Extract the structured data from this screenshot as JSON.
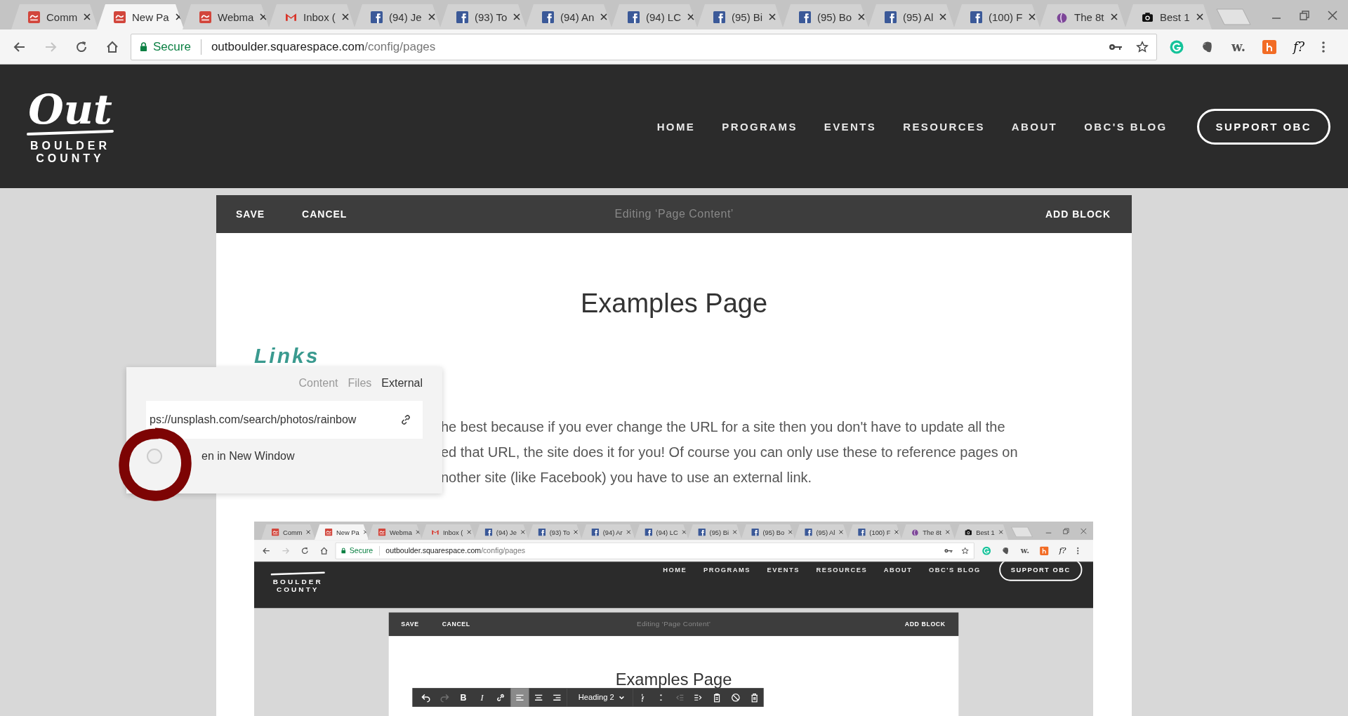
{
  "browser": {
    "tabs": [
      {
        "title": "Comm",
        "kind": "out",
        "selected": false
      },
      {
        "title": "New Pa",
        "kind": "out",
        "selected": true
      },
      {
        "title": "Webma",
        "kind": "out",
        "selected": false
      },
      {
        "title": "Inbox (",
        "kind": "mail",
        "selected": false
      },
      {
        "title": "(94) Je",
        "kind": "social",
        "selected": false
      },
      {
        "title": "(93) To",
        "kind": "social",
        "selected": false
      },
      {
        "title": "(94) An",
        "kind": "social",
        "selected": false
      },
      {
        "title": "(94) LC",
        "kind": "social",
        "selected": false
      },
      {
        "title": "(95) Bi",
        "kind": "social",
        "selected": false
      },
      {
        "title": "(95) Bo",
        "kind": "social",
        "selected": false
      },
      {
        "title": "(95) Al",
        "kind": "social",
        "selected": false
      },
      {
        "title": "(100) F",
        "kind": "social",
        "selected": false
      },
      {
        "title": "The 8t",
        "kind": "onion",
        "selected": false
      },
      {
        "title": "Best 1",
        "kind": "camera",
        "selected": false
      }
    ],
    "address": {
      "secure_label": "Secure",
      "host": "outboulder.squarespace.com",
      "path": "/config/pages"
    },
    "extensions": [
      {
        "kind": "grammarly"
      },
      {
        "kind": "evernote"
      },
      {
        "kind": "text",
        "label": "w."
      },
      {
        "kind": "honey"
      },
      {
        "kind": "text",
        "label": "f?"
      }
    ]
  },
  "site": {
    "logo": {
      "script": "Out",
      "line_1": "BOULDER",
      "line_2": "COUNTY"
    },
    "nav": [
      "HOME",
      "PROGRAMS",
      "EVENTS",
      "RESOURCES",
      "ABOUT",
      "OBC'S BLOG"
    ],
    "cta": "SUPPORT OBC"
  },
  "editor_bar": {
    "save": "SAVE",
    "cancel": "CANCEL",
    "status": "Editing ‘Page Content’",
    "add_block": "ADD BLOCK"
  },
  "page": {
    "title": "Examples Page",
    "heading": "Links",
    "paragraph_lines": [
      "he best because if you ever change the URL for a site then you don't have to update all the",
      "ed that URL, the site does it for you! Of course you can only use these to reference pages on",
      "nother site (like Facebook) you have to use an external link."
    ]
  },
  "link_popup": {
    "tabs": [
      {
        "label": "Content",
        "selected": false
      },
      {
        "label": "Files",
        "selected": false
      },
      {
        "label": "External",
        "selected": true
      }
    ],
    "url": "ps://unsplash.com/search/photos/rainbow",
    "new_window": {
      "label": "en in New Window",
      "checked": false
    }
  },
  "inner_screenshot": {
    "browser": {
      "tabs": [
        {
          "title": "Comm",
          "kind": "out",
          "selected": false
        },
        {
          "title": "New Pa",
          "kind": "out",
          "selected": true
        },
        {
          "title": "Webma",
          "kind": "out",
          "selected": false
        },
        {
          "title": "Inbox (",
          "kind": "mail",
          "selected": false
        },
        {
          "title": "(94) Je",
          "kind": "social",
          "selected": false
        },
        {
          "title": "(93) To",
          "kind": "social",
          "selected": false
        },
        {
          "title": "(94) Ar",
          "kind": "social",
          "selected": false
        },
        {
          "title": "(94) LC",
          "kind": "social",
          "selected": false
        },
        {
          "title": "(95) Bi",
          "kind": "social",
          "selected": false
        },
        {
          "title": "(95) Bo",
          "kind": "social",
          "selected": false
        },
        {
          "title": "(95) Al",
          "kind": "social",
          "selected": false
        },
        {
          "title": "(100) F",
          "kind": "social",
          "selected": false
        },
        {
          "title": "The 8t",
          "kind": "onion",
          "selected": false
        },
        {
          "title": "Best 1",
          "kind": "camera",
          "selected": false
        }
      ],
      "address": {
        "secure_label": "Secure",
        "host": "outboulder.squarespace.com",
        "path": "/config/pages"
      },
      "extensions": [
        {
          "kind": "grammarly"
        },
        {
          "kind": "evernote"
        },
        {
          "kind": "text",
          "label": "w."
        },
        {
          "kind": "honey"
        },
        {
          "kind": "text",
          "label": "f?"
        }
      ]
    },
    "site": {
      "logo": {
        "line_1": "BOULDER",
        "line_2": "COUNTY"
      },
      "nav": [
        "HOME",
        "PROGRAMS",
        "EVENTS",
        "RESOURCES",
        "ABOUT",
        "OBC'S BLOG"
      ],
      "cta": "SUPPORT OBC"
    },
    "editor_bar": {
      "save": "SAVE",
      "cancel": "CANCEL",
      "status": "Editing ‘Page Content’",
      "add_block": "ADD BLOCK"
    },
    "page": {
      "title": "Examples Page"
    },
    "format_toolbar": {
      "left_tools": [
        {
          "kind": "undo",
          "disabled": false
        },
        {
          "kind": "redo",
          "disabled": true
        },
        {
          "kind": "bold",
          "label": "B",
          "disabled": false
        },
        {
          "kind": "italic",
          "label": "I",
          "disabled": false
        },
        {
          "kind": "link",
          "disabled": false
        }
      ],
      "alignment": [
        {
          "kind": "left",
          "selected": true
        },
        {
          "kind": "center",
          "selected": false
        },
        {
          "kind": "right",
          "selected": false
        }
      ],
      "heading_style": "Heading 2",
      "right_tools": [
        {
          "kind": "ordered-list",
          "disabled": false
        },
        {
          "kind": "bullet-list",
          "disabled": false
        },
        {
          "kind": "outdent",
          "disabled": true
        },
        {
          "kind": "indent",
          "disabled": false
        },
        {
          "kind": "clipboard",
          "disabled": false
        },
        {
          "kind": "clear",
          "disabled": false
        },
        {
          "kind": "trash",
          "disabled": false
        }
      ]
    }
  }
}
